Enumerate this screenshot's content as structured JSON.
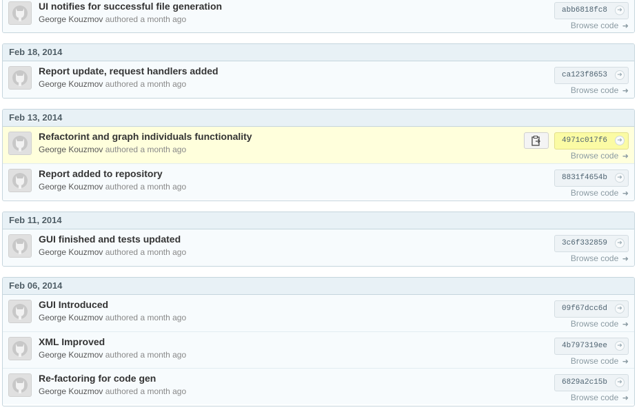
{
  "groups": [
    {
      "date": "",
      "commits": [
        {
          "title": "UI notifies for successful file generation",
          "author": "George Kouzmov",
          "when": "authored a month ago",
          "sha": "abb6818fc8",
          "browse": "Browse code",
          "highlighted": false
        }
      ]
    },
    {
      "date": "Feb 18, 2014",
      "commits": [
        {
          "title": "Report update, request handlers added",
          "author": "George Kouzmov",
          "when": "authored a month ago",
          "sha": "ca123f8653",
          "browse": "Browse code",
          "highlighted": false
        }
      ]
    },
    {
      "date": "Feb 13, 2014",
      "commits": [
        {
          "title": "Refactorint and graph individuals functionality",
          "author": "George Kouzmov",
          "when": "authored a month ago",
          "sha": "4971c017f6",
          "browse": "Browse code",
          "highlighted": true
        },
        {
          "title": "Report added to repository",
          "author": "George Kouzmov",
          "when": "authored a month ago",
          "sha": "8831f4654b",
          "browse": "Browse code",
          "highlighted": false
        }
      ]
    },
    {
      "date": "Feb 11, 2014",
      "commits": [
        {
          "title": "GUI finished and tests updated",
          "author": "George Kouzmov",
          "when": "authored a month ago",
          "sha": "3c6f332859",
          "browse": "Browse code",
          "highlighted": false
        }
      ]
    },
    {
      "date": "Feb 06, 2014",
      "commits": [
        {
          "title": "GUI Introduced",
          "author": "George Kouzmov",
          "when": "authored a month ago",
          "sha": "09f67dcc6d",
          "browse": "Browse code",
          "highlighted": false
        },
        {
          "title": "XML Improved",
          "author": "George Kouzmov",
          "when": "authored a month ago",
          "sha": "4b797319ee",
          "browse": "Browse code",
          "highlighted": false
        },
        {
          "title": "Re-factoring for code gen",
          "author": "George Kouzmov",
          "when": "authored a month ago",
          "sha": "6829a2c15b",
          "browse": "Browse code",
          "highlighted": false
        }
      ]
    }
  ],
  "icons": {
    "avatar": "octocat-avatar-icon",
    "clipboard": "clipboard-icon",
    "sha_arrow": "arrow-right-circle-icon",
    "browse_arrow": "arrow-right-icon"
  },
  "colors": {
    "highlight_row": "#ffffdc",
    "highlight_sha": "#fbfba4",
    "date_header": "#e8f1f6",
    "border": "#c5d5dd"
  }
}
